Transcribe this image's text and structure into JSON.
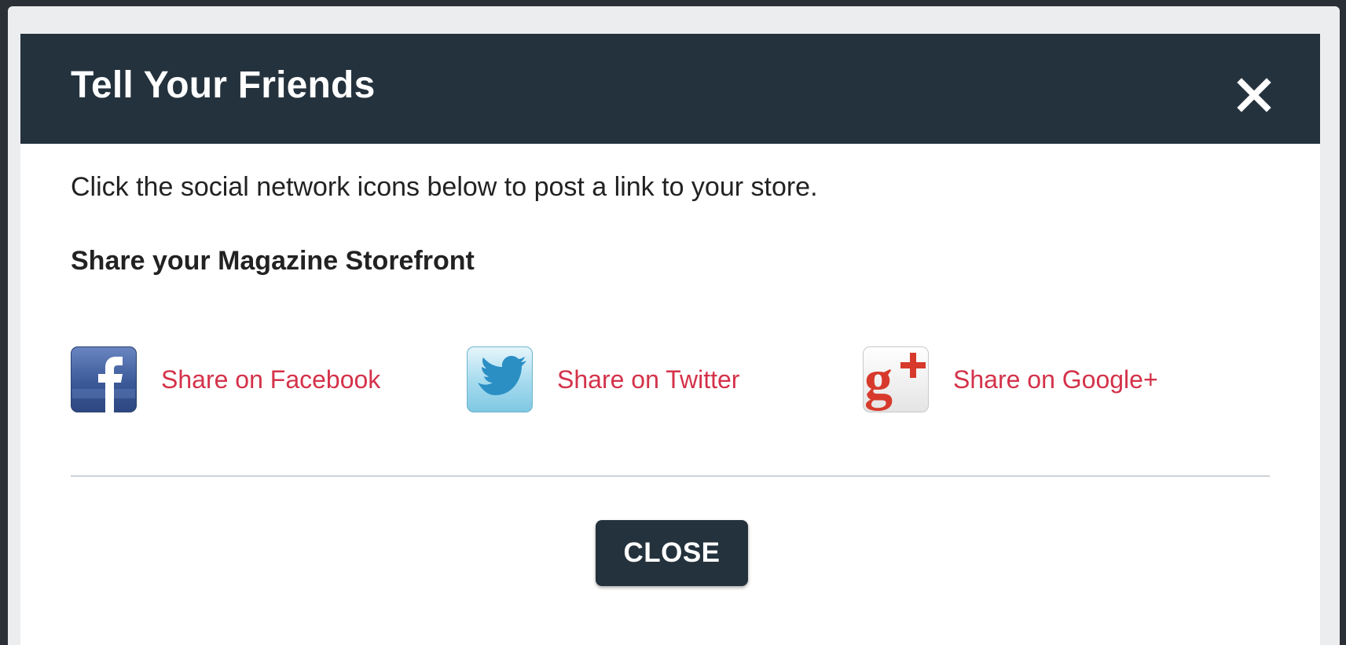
{
  "dialog": {
    "title": "Tell Your Friends",
    "intro_text": "Click the social network icons below to post a link to your store.",
    "subheading": "Share your Magazine Storefront",
    "share_links": [
      {
        "label": "Share on Facebook",
        "icon": "facebook-icon",
        "color": "#3b5998"
      },
      {
        "label": "Share on Twitter",
        "icon": "twitter-icon",
        "color": "#55c3e6"
      },
      {
        "label": "Share on Google+",
        "icon": "google-plus-icon",
        "color": "#d73a2c"
      }
    ],
    "close_button_label": "CLOSE"
  },
  "colors": {
    "header_bg": "#24323d",
    "link": "#d4324a",
    "button_bg": "#24323d"
  }
}
